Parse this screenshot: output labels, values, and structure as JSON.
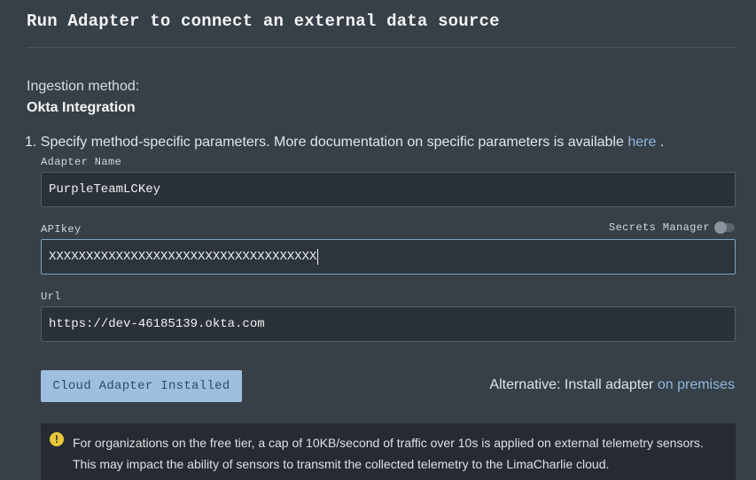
{
  "header": {
    "title": "Run Adapter to connect an external data source"
  },
  "ingestion": {
    "label": "Ingestion method:",
    "value": "Okta Integration"
  },
  "step": {
    "number": "1.",
    "text": "Specify method-specific parameters. More documentation on specific parameters is available",
    "link": "here",
    "suffix": "."
  },
  "fields": {
    "adapter_name": {
      "label": "Adapter Name",
      "value": "PurpleTeamLCKey"
    },
    "apikey": {
      "label": "APIkey",
      "value": "XXXXXXXXXXXXXXXXXXXXXXXXXXXXXXXXXXXX",
      "secrets_label": "Secrets Manager"
    },
    "url": {
      "label": "Url",
      "value": "https://dev-46185139.okta.com"
    }
  },
  "actions": {
    "installed_label": "Cloud Adapter Installed",
    "alternative_text": "Alternative: Install adapter",
    "alternative_link": "on premises"
  },
  "notice": {
    "icon": "warning-icon",
    "text": "For organizations on the free tier, a cap of 10KB/second of traffic over 10s is applied on external telemetry sensors. This may impact the ability of sensors to transmit the collected telemetry to the LimaCharlie cloud."
  }
}
